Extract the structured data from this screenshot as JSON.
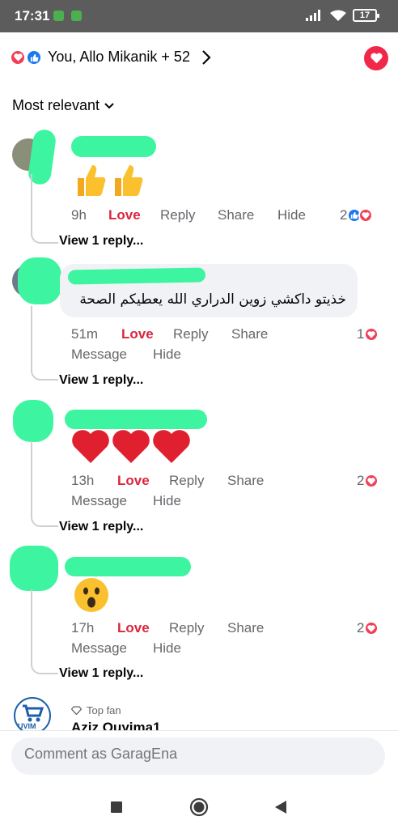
{
  "status_bar": {
    "time": "17:31",
    "battery": "17"
  },
  "header": {
    "reactors": "You, Allo Mikanik + 52"
  },
  "sort": {
    "label": "Most relevant"
  },
  "comments": [
    {
      "time": "9h",
      "love": "Love",
      "reply": "Reply",
      "share": "Share",
      "hide": "Hide",
      "count": "2",
      "view_replies": "View 1 reply..."
    },
    {
      "time": "51m",
      "love": "Love",
      "reply": "Reply",
      "share": "Share",
      "message": "Message",
      "hide": "Hide",
      "count": "1",
      "text": "خذيتو داكشي زوين الدراري  الله يعطيكم الصحة",
      "view_replies": "View 1 reply..."
    },
    {
      "time": "13h",
      "love": "Love",
      "reply": "Reply",
      "share": "Share",
      "message": "Message",
      "hide": "Hide",
      "count": "2",
      "view_replies": "View 1 reply..."
    },
    {
      "time": "17h",
      "love": "Love",
      "reply": "Reply",
      "share": "Share",
      "message": "Message",
      "hide": "Hide",
      "count": "2",
      "view_replies": "View 1 reply..."
    }
  ],
  "last_comment": {
    "badge": "Top fan",
    "author": "Aziz Ouyima1",
    "avatar_text": "UVIM"
  },
  "composer": {
    "placeholder": "Comment as GaragEna"
  },
  "icons": [
    "square-icon",
    "home-circle-icon",
    "back-triangle-icon",
    "heart-icon",
    "thumbs-up-icon",
    "chevron-right-icon",
    "chevron-down-icon",
    "diamond-icon"
  ],
  "colors": {
    "love": "#f33e58",
    "like": "#1877f2",
    "love_label": "#d9263e",
    "highlight_scribble": "#3df5a0",
    "status_bar": "#5c5c5c"
  }
}
